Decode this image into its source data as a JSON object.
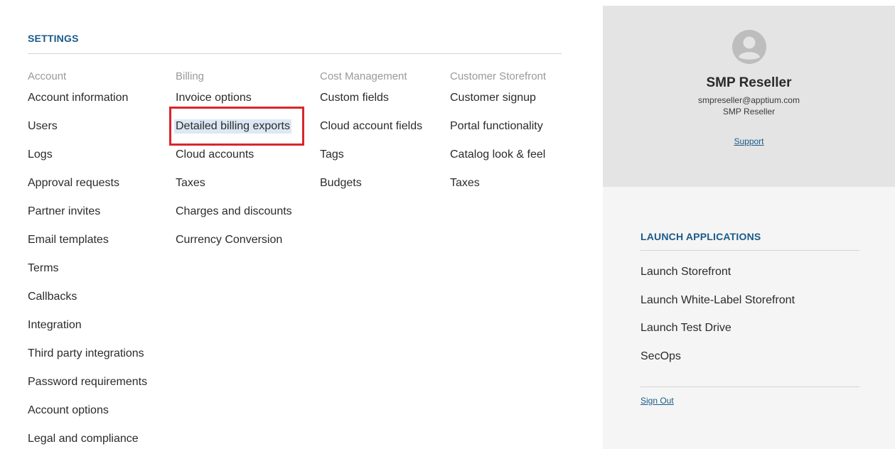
{
  "settings": {
    "title": "SETTINGS",
    "columns": [
      {
        "heading": "Account",
        "items": [
          "Account information",
          "Users",
          "Logs",
          "Approval requests",
          "Partner invites",
          "Email templates",
          "Terms",
          "Callbacks",
          "Integration",
          "Third party integrations",
          "Password requirements",
          "Account options",
          "Legal and compliance"
        ]
      },
      {
        "heading": "Billing",
        "items": [
          "Invoice options",
          "Detailed billing exports",
          "Cloud accounts",
          "Taxes",
          "Charges and discounts",
          "Currency Conversion"
        ]
      },
      {
        "heading": "Cost Management",
        "items": [
          "Custom fields",
          "Cloud account fields",
          "Tags",
          "Budgets"
        ]
      },
      {
        "heading": "Customer Storefront",
        "items": [
          "Customer signup",
          "Portal functionality",
          "Catalog look & feel",
          "Taxes"
        ]
      }
    ],
    "highlighted_item": "Detailed billing exports"
  },
  "account": {
    "avatar_icon": "user-circle-icon",
    "name": "SMP Reseller",
    "email": "smpreseller@apptium.com",
    "organization": "SMP Reseller",
    "support_label": "Support"
  },
  "launch": {
    "title": "LAUNCH APPLICATIONS",
    "items": [
      "Launch Storefront",
      "Launch White-Label Storefront",
      "Launch Test Drive",
      "SecOps"
    ],
    "sign_out_label": "Sign Out"
  },
  "colors": {
    "accent": "#1a5a8a",
    "highlight": "#dce8f4",
    "annotation_box": "#d8262c",
    "account_panel": "#e4e4e4",
    "launch_panel": "#f5f5f5"
  }
}
